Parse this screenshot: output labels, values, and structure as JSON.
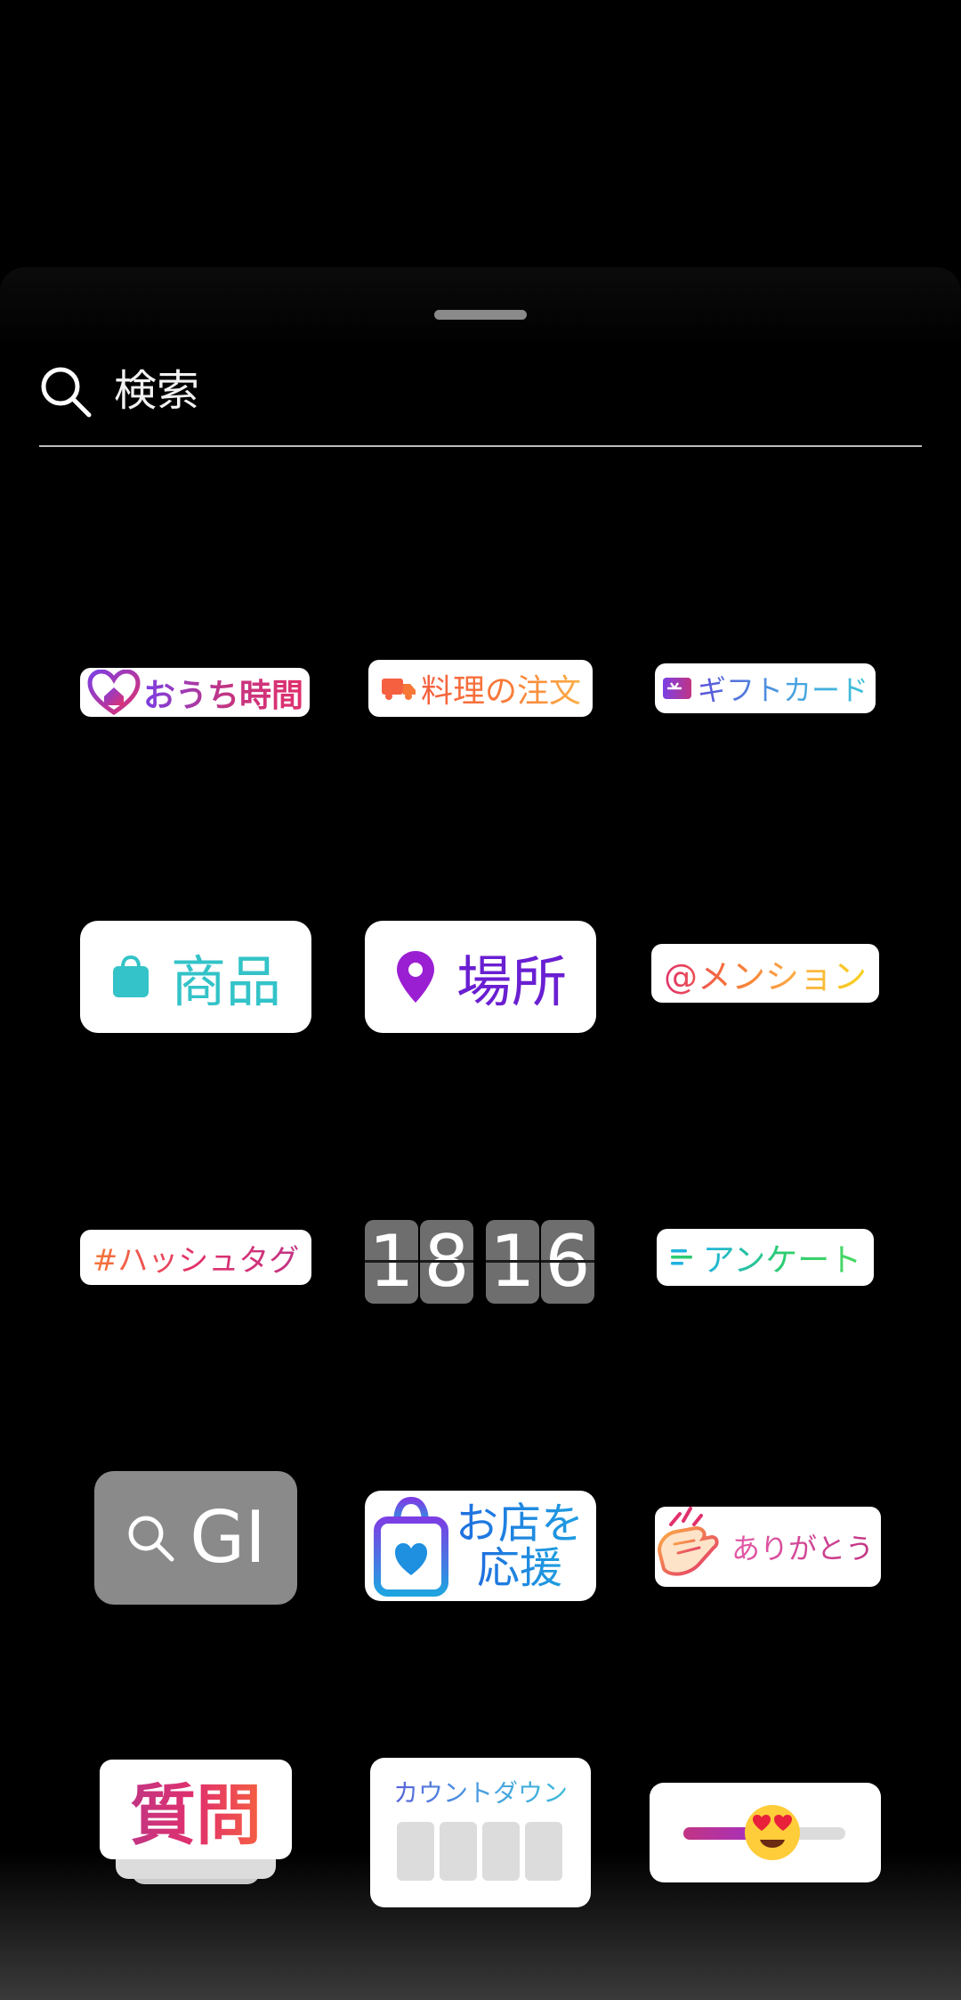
{
  "search": {
    "placeholder": "検索"
  },
  "stickers": {
    "home_time": {
      "label": "おうち時間"
    },
    "food_order": {
      "label": "料理の注文"
    },
    "gift_card": {
      "label": "ギフトカード"
    },
    "product": {
      "label": "商品"
    },
    "location": {
      "label": "場所"
    },
    "mention": {
      "label": "@メンション"
    },
    "hashtag": {
      "label": "#ハッシュタグ"
    },
    "clock": {
      "digits": [
        "1",
        "8",
        "1",
        "6"
      ]
    },
    "poll": {
      "label": "アンケート"
    },
    "gif_search": {
      "label": "GI"
    },
    "support_shop": {
      "line1": "お店を",
      "line2": "応援"
    },
    "thanks": {
      "label": "ありがとう"
    },
    "question": {
      "label": "質問"
    },
    "countdown": {
      "label": "カウントダウン"
    }
  },
  "colors": {
    "background": "#000000",
    "gif_tile": "#8a8a8a",
    "product_teal": "#33c3c8",
    "location_purple": "#7a1fd2"
  }
}
